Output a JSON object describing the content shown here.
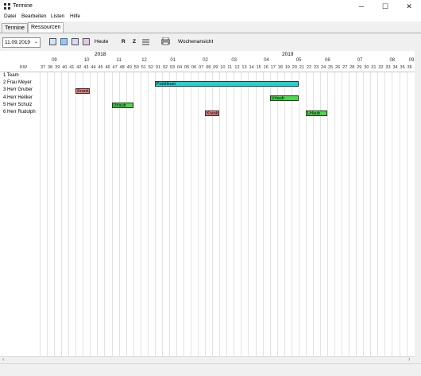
{
  "window": {
    "title": "Termine",
    "min": "─",
    "max": "☐",
    "close": "✕"
  },
  "menu": [
    {
      "label": "Datei"
    },
    {
      "label": "Bearbeiten"
    },
    {
      "label": "Listen"
    },
    {
      "label": "Hilfe"
    }
  ],
  "tabs": [
    {
      "label": "Termine",
      "active": false
    },
    {
      "label": "Ressourcen",
      "active": true
    }
  ],
  "toolbar": {
    "date_value": "11.09.2019",
    "dropdown_arrow": "⌄",
    "icons": [
      "calendar-day-icon",
      "calendar-week-icon",
      "calendar-month-icon",
      "calendar-year-icon"
    ],
    "today_label": "Heute",
    "r_label": "R",
    "z_label": "Z",
    "list_icon": "list-icon",
    "print_icon": "printer-icon",
    "week_view_label": "Wochenansicht"
  },
  "timeline": {
    "years": [
      {
        "label": "2018"
      },
      {
        "label": "2019"
      }
    ],
    "months": [
      "09",
      "10",
      "11",
      "12",
      "01",
      "02",
      "03",
      "04",
      "05",
      "06",
      "07",
      "08",
      "09"
    ],
    "kw_header": "KW",
    "weeks": [
      "37",
      "38",
      "39",
      "40",
      "41",
      "42",
      "43",
      "44",
      "45",
      "46",
      "47",
      "48",
      "49",
      "50",
      "51",
      "52",
      "01",
      "02",
      "03",
      "04",
      "05",
      "06",
      "07",
      "08",
      "09",
      "10",
      "11",
      "12",
      "13",
      "14",
      "15",
      "16",
      "17",
      "18",
      "19",
      "20",
      "21",
      "22",
      "23",
      "24",
      "25",
      "26",
      "27",
      "28",
      "29",
      "30",
      "31",
      "32",
      "33",
      "34",
      "35",
      "36"
    ]
  },
  "resources": [
    {
      "label": "1 Team"
    },
    {
      "label": "2 Frau Meyer"
    },
    {
      "label": "3 Herr Gruber"
    },
    {
      "label": "4 Herr Heilker"
    },
    {
      "label": "5 Herr Schulz"
    },
    {
      "label": "6 Herr Rudolph"
    }
  ],
  "bookings": [
    {
      "row": 1,
      "start_week_index": 16,
      "end_week_index": 36,
      "label": "Praktikum",
      "color": "#22d3cf"
    },
    {
      "row": 2,
      "start_week_index": 5,
      "end_week_index": 7,
      "label": "Krank",
      "color": "#f08080"
    },
    {
      "row": 3,
      "start_week_index": 32,
      "end_week_index": 36,
      "label": "Urlaub",
      "color": "#44dd44"
    },
    {
      "row": 4,
      "start_week_index": 10,
      "end_week_index": 13,
      "label": "Urlaub",
      "color": "#44dd44"
    },
    {
      "row": 5,
      "start_week_index": 23,
      "end_week_index": 25,
      "label": "Krank",
      "color": "#f08080"
    },
    {
      "row": 5,
      "start_week_index": 37,
      "end_week_index": 40,
      "label": "Urlaub",
      "color": "#44dd44"
    }
  ],
  "colors": {
    "accent": "#e8b0b0",
    "grid": "#e2e2e2"
  }
}
